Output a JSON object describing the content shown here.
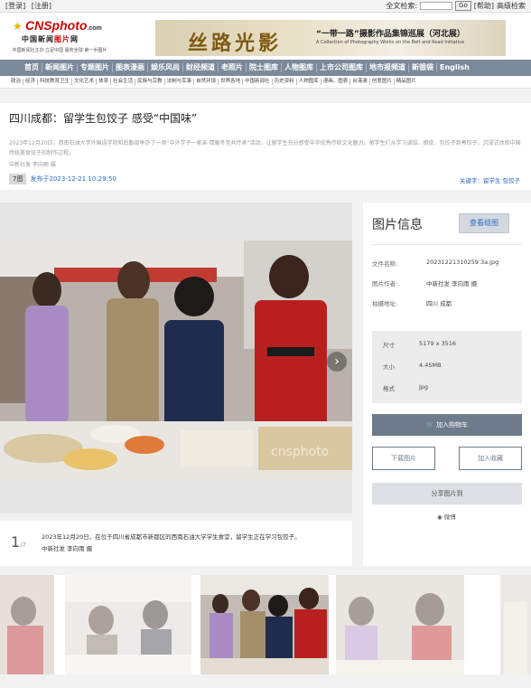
{
  "topbar": {
    "login": "[登录]",
    "register": "[注册]",
    "search_label": "全文检索:",
    "go": "Go",
    "help": "[帮助]",
    "advanced": "高级检索"
  },
  "logo": {
    "brand": "CNSphoto",
    "brand_suffix": ".com",
    "cn_prefix": "中国新闻",
    "cn_highlight": "图片",
    "cn_suffix": "网",
    "sub": "·中国新闻社主办·立足中国 服务全球·第一手图片"
  },
  "banner": {
    "calligraphy": "丝路光影",
    "title": "“一带一路”摄影作品集锦巡展（河北展）",
    "subtitle": "A Collection of Photography Works on the Belt and Road Initiative"
  },
  "nav": [
    "首页",
    "新闻图片",
    "专题图片",
    "图表漫画",
    "娱乐风尚",
    "财经频道",
    "老照片",
    "院士图库",
    "人物图库",
    "上市公司图库",
    "地市报频道",
    "新银袋",
    "English"
  ],
  "subnav": [
    "政治",
    "经济",
    "科技教育卫生",
    "文化艺术",
    "体育",
    "社会生活",
    "民族与宗教",
    "法制与军事",
    "自然环境",
    "世界各地",
    "中国新闻社",
    "历史资料",
    "人物图库",
    "漫画、图表",
    "台港澳",
    "创意图片",
    "精品图片"
  ],
  "article": {
    "title": "四川成都：留学生包饺子 感受“中国味”",
    "desc": "2023年12月20日，西南石油大学外国语学院和后勤部举办了一场“中外学子一家亲 情暖冬至共传承”活动，让留学生充分感受中华优秀传统文化魅力。留学生们从学习调馅、擀皮、包饺子到煮饺子，沉浸式体验中国传统美食饺子的制作过程。",
    "source": "中新社发 李向雨 摄",
    "count": "7图",
    "date": "发布于2023-12-21 10:29:50",
    "keywords": "关键字：留学生 包饺子"
  },
  "photo": {
    "watermark": "cnsphoto",
    "next": "›"
  },
  "caption": {
    "page": "1",
    "total": "/7",
    "text": "2023年12月20日，在位于四川省成都市新都区的西南石油大学学生食堂，留学生正在学习包饺子。",
    "credit": "中新社发 李向雨 摄"
  },
  "info": {
    "title": "图片信息",
    "view_set": "查看组图",
    "filename_label": "文件名称:",
    "filename": "20231221310259 3a.jpg",
    "author_label": "图片作者:",
    "author": "中新社发 李向雨 摄",
    "location_label": "拍摄地址:",
    "location": "四川 成都",
    "size_label": "尺寸",
    "size": "5179 x 3516",
    "filesize_label": "大小",
    "filesize": "4.45MB",
    "format_label": "格式",
    "format": "jpg",
    "cart": "加入购物车",
    "download": "下载图片",
    "favorite": "加入收藏",
    "share": "分享图片到",
    "weibo": "微博"
  },
  "colors": {
    "nav_bg": "#7b8a9b",
    "link": "#2a6bbf",
    "cart_bg": "#6e7b8b"
  }
}
